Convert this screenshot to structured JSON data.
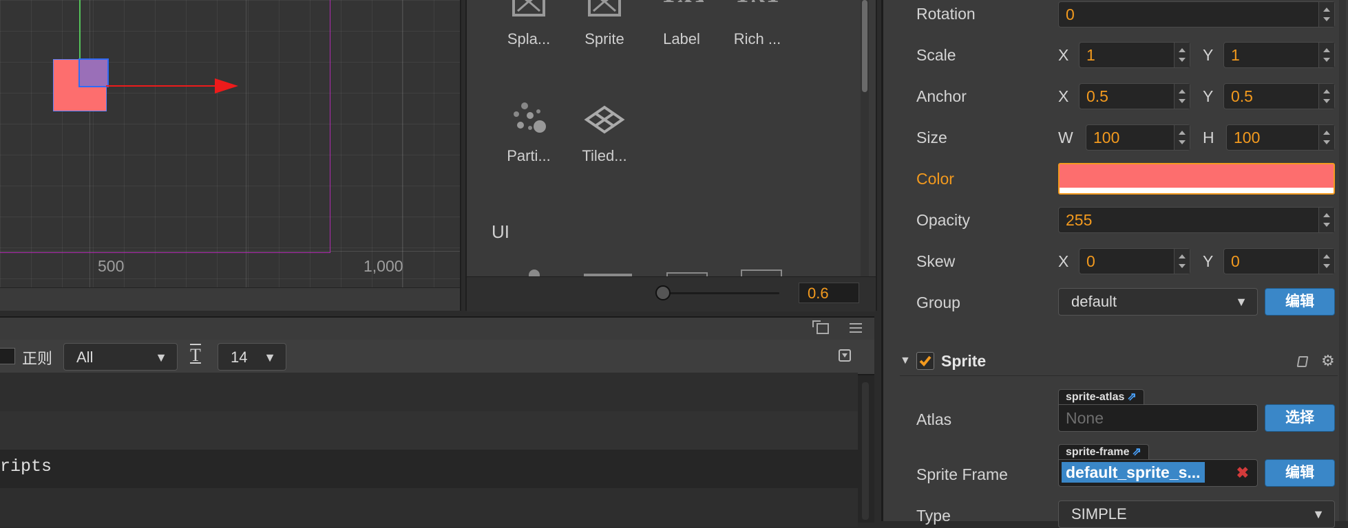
{
  "scene": {
    "ticks": {
      "x500": "500",
      "x1000": "1,000"
    }
  },
  "library": {
    "items": [
      {
        "label": "Spla...",
        "icon": "splash-sprite-icon"
      },
      {
        "label": "Sprite",
        "icon": "sprite-icon"
      },
      {
        "label": "Label",
        "icon": "label-icon",
        "glyph": "TxT"
      },
      {
        "label": "Rich ...",
        "icon": "richtext-icon",
        "glyph": "TxT"
      },
      {
        "label": "Parti...",
        "icon": "particle-icon"
      },
      {
        "label": "Tiled...",
        "icon": "tiledmap-icon"
      }
    ],
    "ui_heading": "UI",
    "zoom_value": "0.6"
  },
  "console": {
    "regex_label": "正则",
    "level_select": "All",
    "font_size_select": "14",
    "log_line": "ripts"
  },
  "inspector": {
    "rotation": {
      "label": "Rotation",
      "value": "0"
    },
    "scale": {
      "label": "Scale",
      "x_label": "X",
      "x": "1",
      "y_label": "Y",
      "y": "1"
    },
    "anchor": {
      "label": "Anchor",
      "x_label": "X",
      "x": "0.5",
      "y_label": "Y",
      "y": "0.5"
    },
    "size": {
      "label": "Size",
      "w_label": "W",
      "w": "100",
      "h_label": "H",
      "h": "100"
    },
    "color": {
      "label": "Color",
      "value_hex": "#fd6e6e"
    },
    "opacity": {
      "label": "Opacity",
      "value": "255"
    },
    "skew": {
      "label": "Skew",
      "x_label": "X",
      "x": "0",
      "y_label": "Y",
      "y": "0"
    },
    "group": {
      "label": "Group",
      "value": "default",
      "edit_button": "编辑"
    },
    "sprite_component": {
      "title": "Sprite",
      "atlas": {
        "label": "Atlas",
        "tag": "sprite-atlas",
        "value": "None",
        "select_button": "选择"
      },
      "sprite_frame": {
        "label": "Sprite Frame",
        "tag": "sprite-frame",
        "value": "default_sprite_s...",
        "edit_button": "编辑"
      },
      "type": {
        "label": "Type",
        "value": "SIMPLE"
      }
    }
  },
  "colors": {
    "accent_orange": "#f39a1e",
    "button_blue": "#3a87c8",
    "node_color": "#fd6e6e"
  }
}
